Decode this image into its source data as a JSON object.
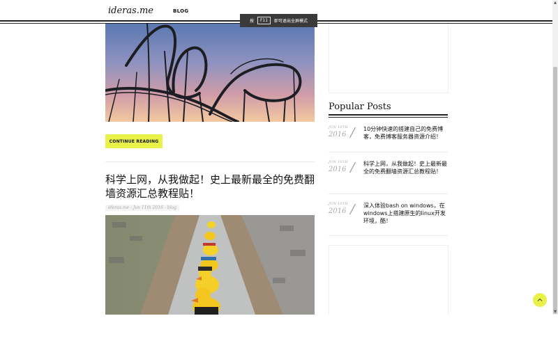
{
  "header": {
    "logo": "ideras.me",
    "nav_blog": "BLOG"
  },
  "fullscreen_tip": {
    "prefix": "按",
    "key": "F11",
    "suffix": "即可退出全屏模式"
  },
  "posts": {
    "continue_label": "CONTINUE READING",
    "second": {
      "title": "科学上网，从我做起！史上最新最全的免费翻墙资源汇总教程贴！",
      "meta": "ideras.me - Jun 11th 2016 - blog"
    }
  },
  "sidebar": {
    "heading": "Popular Posts",
    "items": [
      {
        "month_day": "JUN 10TH",
        "year": "2016",
        "title": "10分钟快速的搭建自己的免费博客，免费博客服务器资源介绍！"
      },
      {
        "month_day": "JUN 10TH",
        "year": "2016",
        "title": "科学上网，从我做起！史上最新最全的免费翻墙资源汇总教程贴！"
      },
      {
        "month_day": "JUN 10TH",
        "year": "2016",
        "title": "深入体验bash on windows，在windows上搭建原生的linux开发环境，酷！"
      }
    ]
  },
  "colors": {
    "accent": "#eaf24a",
    "text": "#111111",
    "muted": "#aaaaaa"
  },
  "icons": {
    "back_to_top": "chevron-up-icon",
    "scroll_up": "triangle-up-icon",
    "scroll_down": "triangle-down-icon"
  }
}
